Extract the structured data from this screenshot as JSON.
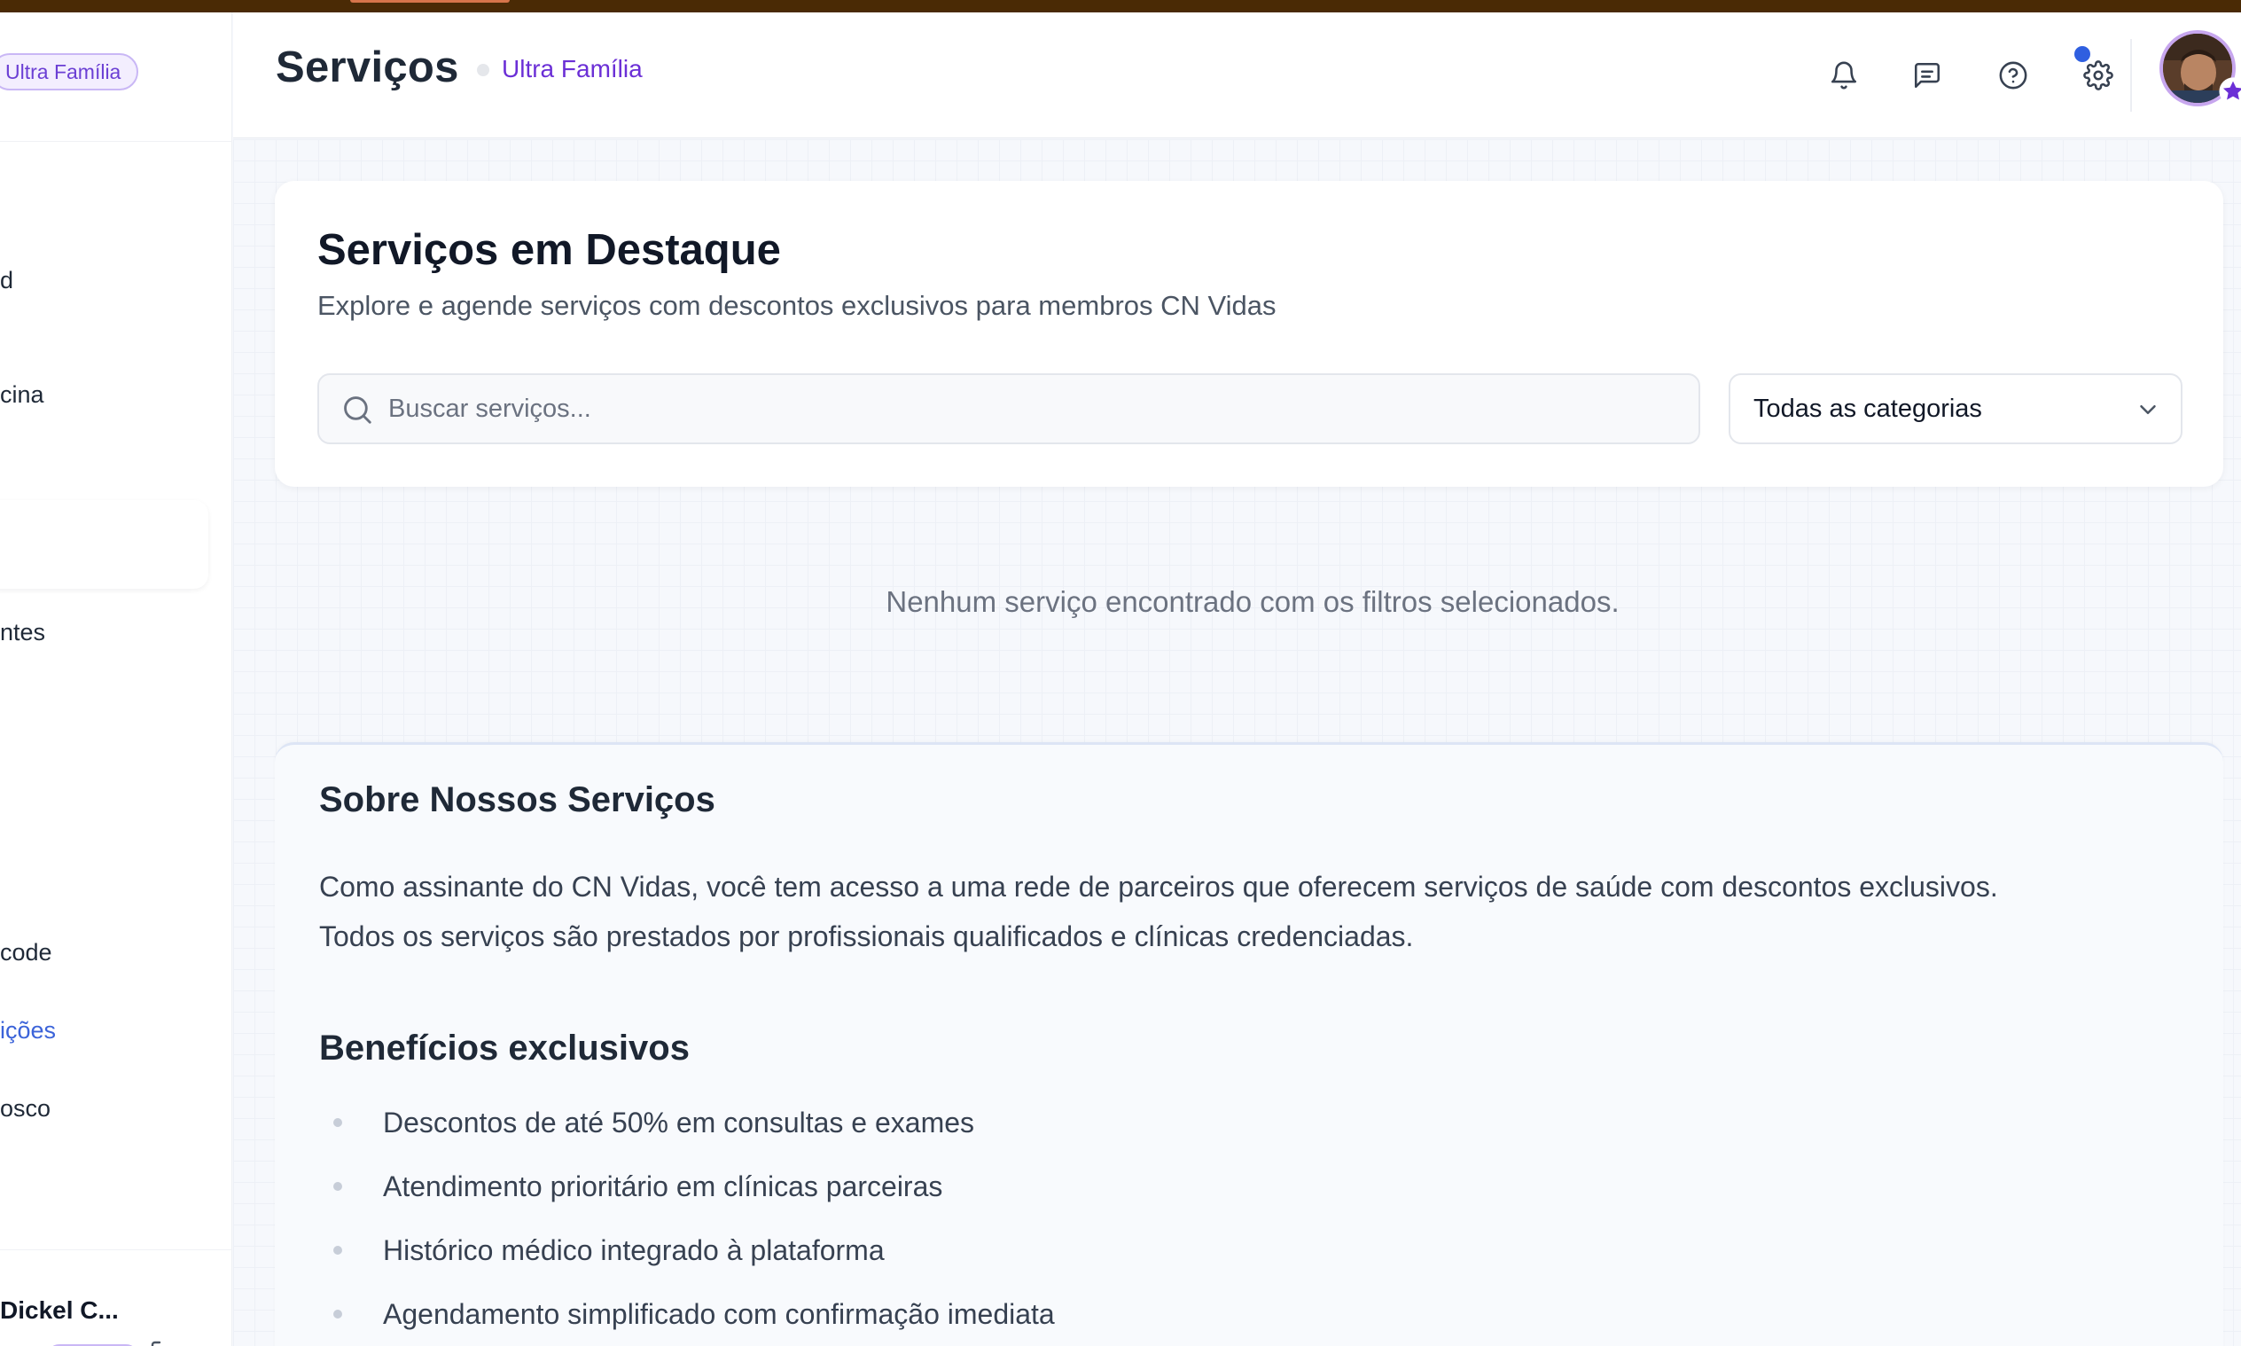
{
  "sidebar": {
    "plan_badge": "Ultra Família",
    "items": [
      {
        "label": "d"
      },
      {
        "label": "cina"
      },
      {
        "label": "ntes"
      },
      {
        "label": "code"
      },
      {
        "label": "ições"
      },
      {
        "label": "osco"
      }
    ],
    "user_name": "Dickel C..."
  },
  "header": {
    "title": "Serviços",
    "plan": "Ultra Família",
    "notification_indicator": true
  },
  "featured": {
    "title": "Serviços em Destaque",
    "subtitle": "Explore e agende serviços com descontos exclusivos para membros CN Vidas",
    "search_placeholder": "Buscar serviços...",
    "category_selected": "Todas as categorias"
  },
  "empty_message": "Nenhum serviço encontrado com os filtros selecionados.",
  "about": {
    "title": "Sobre Nossos Serviços",
    "line1": "Como assinante do CN Vidas, você tem acesso a uma rede de parceiros que oferecem serviços de saúde com descontos exclusivos.",
    "line2": "Todos os serviços são prestados por profissionais qualificados e clínicas credenciadas.",
    "benefits_title": "Benefícios exclusivos",
    "benefits": [
      "Descontos de até 50% em consultas e exames",
      "Atendimento prioritário em clínicas parceiras",
      "Histórico médico integrado à plataforma",
      "Agendamento simplificado com confirmação imediata"
    ]
  },
  "colors": {
    "accent_purple": "#6b2fd6",
    "active_blue": "#3b63d9",
    "notification_blue": "#2f5fe0"
  }
}
